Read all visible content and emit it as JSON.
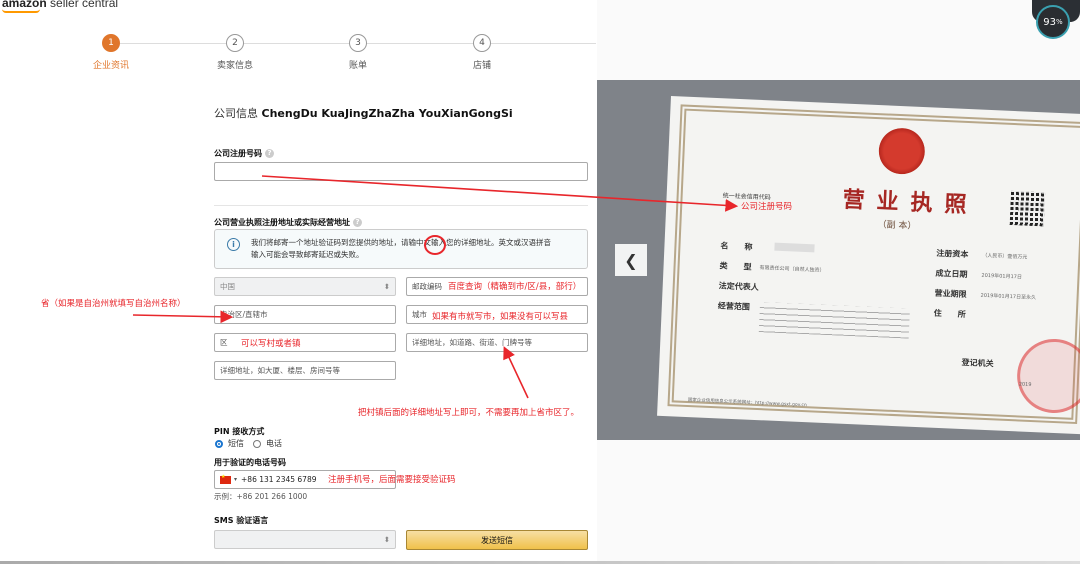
{
  "header": {
    "logo_brand": "amazon",
    "logo_product": "seller central"
  },
  "stepper": [
    {
      "num": "1",
      "label": "企业资讯",
      "active": true
    },
    {
      "num": "2",
      "label": "卖家信息",
      "active": false
    },
    {
      "num": "3",
      "label": "账单",
      "active": false
    },
    {
      "num": "4",
      "label": "店铺",
      "active": false
    }
  ],
  "form": {
    "company_prefix": "公司信息",
    "company_name": "ChengDu KuaJingZhaZha YouXianGongSi",
    "reg_number_label": "公司注册号码",
    "reg_number_value": "",
    "address_label": "公司营业执照注册地址或实际经营地址",
    "info_line1": "我们将邮寄一个地址验证码到您提供的地址，请输",
    "info_highlight": "中文",
    "info_line1b": "输入您的详细地址。英文或汉语拼音",
    "info_line2": "输入可能会导致邮寄延迟或失败。",
    "country": "中国",
    "postal_placeholder": "邮政编码",
    "province_value": "自治区/直辖市",
    "city_placeholder": "城市",
    "district_value": "区",
    "street_placeholder": "详细地址，如道路、街道、门牌号等",
    "building_placeholder": "详细地址，如大厦、楼层、房间号等",
    "pin_label": "PIN 接收方式",
    "pin_sms": "短信",
    "pin_phone": "电话",
    "phone_label": "用于验证的电话号码",
    "phone_value": "+86 131 2345 6789",
    "phone_example": "示例：+86 201 266 1000",
    "sms_lang_label": "SMS 验证语言",
    "send_button": "发送短信"
  },
  "annotations": {
    "company_reg": "公司注册号码",
    "postal": "百度查询（精确到市/区/县，部行）",
    "province": "省（如果是自治州就填写自治州名称）",
    "city": "如果有市就写市，如果没有可以写县",
    "district": "可以写村或者镇",
    "street": "把村镇后面的详细地址写上即可，不需要再加上省市区了。",
    "phone": "注册手机号，后面需要接受验证码"
  },
  "certificate": {
    "title": "营业执照",
    "subtitle": "（副 本）",
    "credit_code_label": "统一社会信用代码",
    "name_label": "名　　称",
    "type_label": "类　　型",
    "type_value": "有限责任公司（自然人独资）",
    "legal_label": "法定代表人",
    "scope_label": "经营范围",
    "capital_label": "注册资本",
    "capital_value": "（人民币）壹佰万元",
    "founded_label": "成立日期",
    "founded_value": "2019年01月17日",
    "term_label": "营业期限",
    "term_value": "2019年01月17日至永久",
    "address_label": "住　　所",
    "authority_label": "登记机关",
    "year": "2019",
    "site": "国家企业信用信息公示系统网址：http://www.gsxt.gov.cn"
  },
  "overlay": {
    "badge_percent": "93",
    "badge_unit": "%"
  },
  "colors": {
    "accent": "#e0762b",
    "annotation": "#e8262b",
    "cert_red": "#a62723"
  }
}
